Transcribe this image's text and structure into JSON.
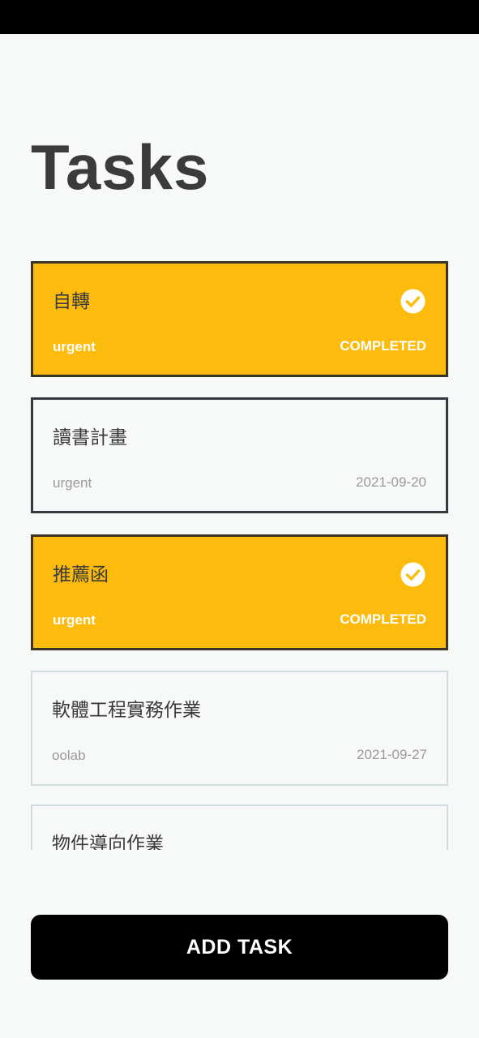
{
  "header": {
    "title": "Tasks"
  },
  "tasks": [
    {
      "name": "自轉",
      "tag": "urgent",
      "status": "COMPLETED",
      "completed": true
    },
    {
      "name": "讀書計畫",
      "tag": "urgent",
      "status": "2021-09-20",
      "completed": false
    },
    {
      "name": "推薦函",
      "tag": "urgent",
      "status": "COMPLETED",
      "completed": true
    },
    {
      "name": "軟體工程實務作業",
      "tag": "oolab",
      "status": "2021-09-27",
      "completed": false
    },
    {
      "name": "物件導向作業",
      "completed": false
    }
  ],
  "actions": {
    "add_task_label": "ADD TASK"
  },
  "colors": {
    "completed_background": "#fdbb0d",
    "completed_border": "#3a3424",
    "button_background": "#000000",
    "title_text": "#3b3b3b"
  }
}
